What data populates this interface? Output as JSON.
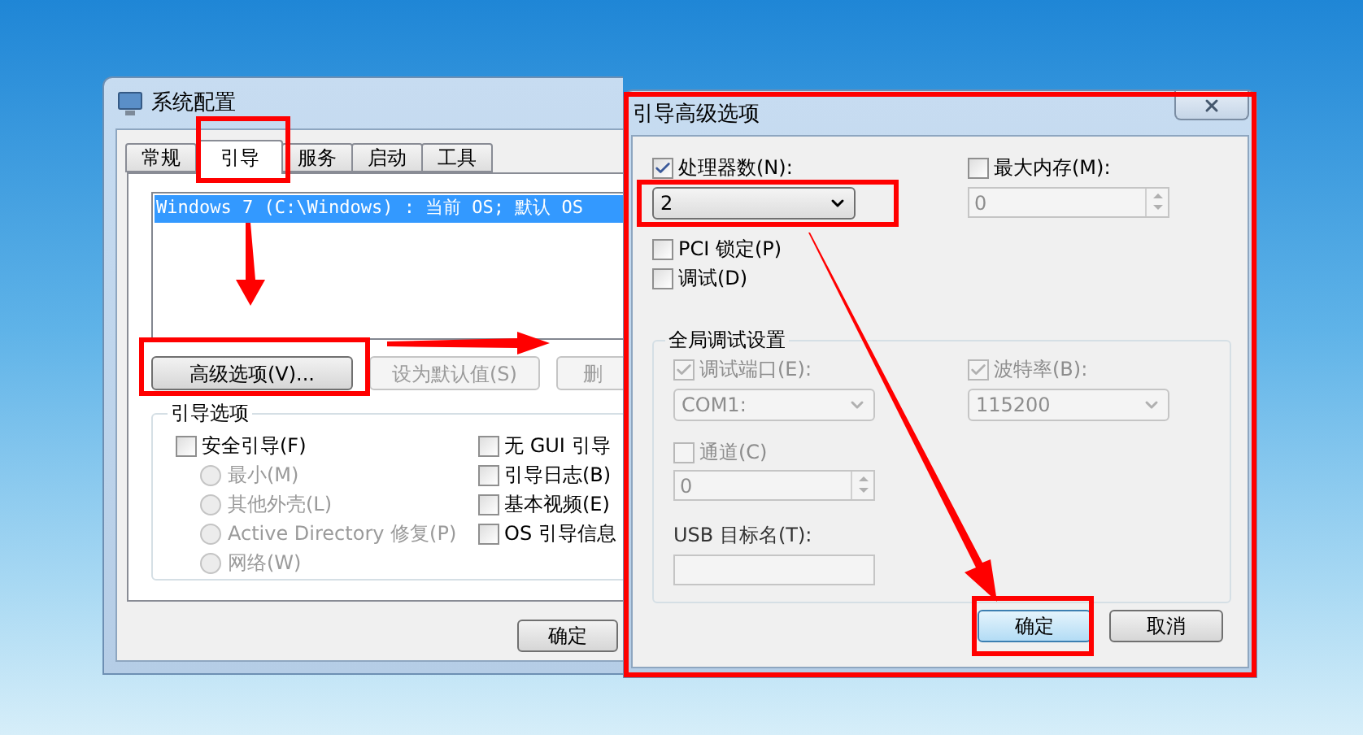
{
  "system_config": {
    "title": "系统配置",
    "tabs": [
      {
        "label": "常规",
        "selected": false
      },
      {
        "label": "引导",
        "selected": true
      },
      {
        "label": "服务",
        "selected": false
      },
      {
        "label": "启动",
        "selected": false
      },
      {
        "label": "工具",
        "selected": false
      }
    ],
    "boot_entries": [
      {
        "text": "Windows 7 (C:\\Windows) : 当前 OS; 默认 OS",
        "selected": true
      }
    ],
    "buttons": [
      {
        "label": "高级选项(V)...",
        "disabled": false
      },
      {
        "label": "设为默认值(S)",
        "disabled": true
      },
      {
        "label": "删",
        "disabled": true
      }
    ],
    "boot_options": {
      "title": "引导选项",
      "safe_boot": {
        "label": "安全引导(F)",
        "checked": false
      },
      "safe_boot_modes": [
        {
          "label": "最小(M)",
          "selected": false,
          "disabled": true
        },
        {
          "label": "其他外壳(L)",
          "selected": false,
          "disabled": true
        },
        {
          "label": "Active Directory 修复(P)",
          "selected": false,
          "disabled": true
        },
        {
          "label": "网络(W)",
          "selected": false,
          "disabled": true
        }
      ],
      "flags": [
        {
          "label": "无 GUI 引导",
          "checked": false
        },
        {
          "label": "引导日志(B)",
          "checked": false
        },
        {
          "label": "基本视频(E)",
          "checked": false
        },
        {
          "label": "OS 引导信息",
          "checked": false
        }
      ]
    },
    "ok_button": "确定"
  },
  "advanced_options": {
    "title": "引导高级选项",
    "processors": {
      "label": "处理器数(N):",
      "checked": true,
      "value": "2"
    },
    "max_memory": {
      "label": "最大内存(M):",
      "checked": false,
      "value": "0"
    },
    "pci_lock": {
      "label": "PCI 锁定(P)",
      "checked": false
    },
    "debug": {
      "label": "调试(D)",
      "checked": false
    },
    "global_debug": {
      "title": "全局调试设置",
      "disabled": true,
      "debug_port": {
        "label": "调试端口(E):",
        "checked": true,
        "value": "COM1:"
      },
      "baud_rate": {
        "label": "波特率(B):",
        "checked": true,
        "value": "115200"
      },
      "channel": {
        "label": "通道(C)",
        "checked": false,
        "value": "0"
      },
      "usb_target": {
        "label": "USB 目标名(T):"
      }
    },
    "buttons": [
      {
        "label": "确定",
        "default": true
      },
      {
        "label": "取消",
        "default": false
      }
    ]
  }
}
